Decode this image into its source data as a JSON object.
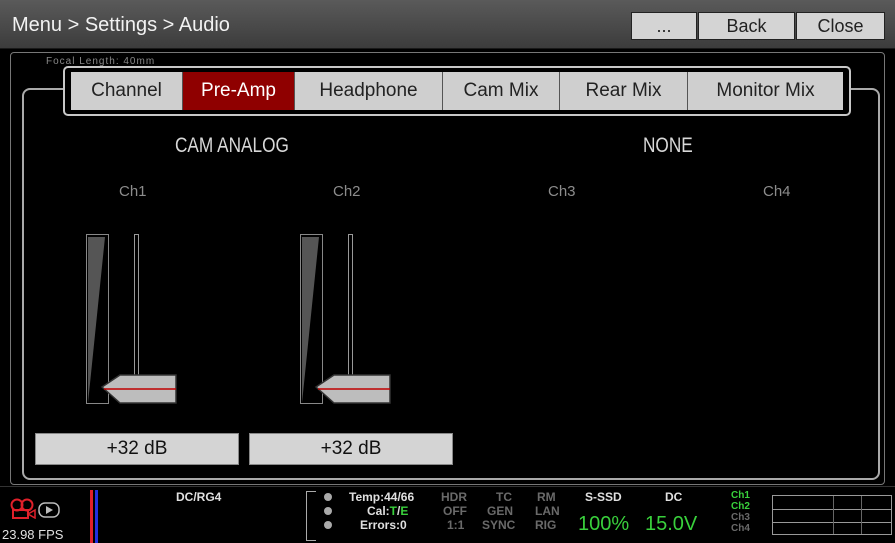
{
  "header": {
    "breadcrumb": "Menu > Settings > Audio",
    "more_label": "...",
    "back_label": "Back",
    "close_label": "Close"
  },
  "focal_length_text": "Focal Length: 40mm",
  "tabs": [
    {
      "label": "Channel",
      "active": false
    },
    {
      "label": "Pre-Amp",
      "active": true
    },
    {
      "label": "Headphone",
      "active": false
    },
    {
      "label": "Cam Mix",
      "active": false
    },
    {
      "label": "Rear Mix",
      "active": false
    },
    {
      "label": "Monitor Mix",
      "active": false
    }
  ],
  "groups": {
    "left": "CAM ANALOG",
    "right": "NONE"
  },
  "channels": [
    "Ch1",
    "Ch2",
    "Ch3",
    "Ch4"
  ],
  "preamp": [
    {
      "channel": "Ch1",
      "value": "+32 dB",
      "level": 0.0
    },
    {
      "channel": "Ch2",
      "value": "+32 dB",
      "level": 0.0
    }
  ],
  "status": {
    "fps": "23.98 FPS",
    "media": "DC/RG4",
    "temp": "Temp:44/66",
    "cal_label": "Cal:",
    "cal_t": "T",
    "cal_sep": "/",
    "cal_e": "E",
    "errors": "Errors:0",
    "hdr": [
      "HDR",
      "OFF",
      "1:1"
    ],
    "tc": [
      "TC",
      "GEN",
      "SYNC"
    ],
    "rm": [
      "RM",
      "LAN",
      "RIG"
    ],
    "storage_label": "S-SSD",
    "storage_value": "100%",
    "power_label": "DC",
    "power_value": "15.0V",
    "audio_channels": [
      "Ch1",
      "Ch2",
      "Ch3",
      "Ch4"
    ]
  },
  "colors": {
    "active_tab": "#8f0000",
    "status_green": "#39d03c",
    "record_red": "#e0202a"
  }
}
